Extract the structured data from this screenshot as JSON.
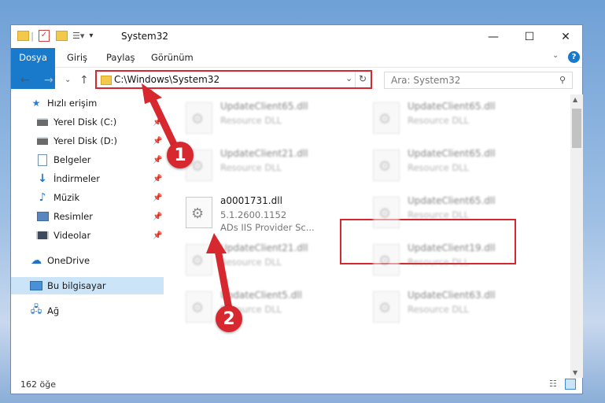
{
  "window": {
    "title": "System32"
  },
  "ribbon": {
    "tabs": [
      "Dosya",
      "Giriş",
      "Paylaş",
      "Görünüm"
    ]
  },
  "address": {
    "path": "C:\\Windows\\System32"
  },
  "search": {
    "placeholder": "Ara: System32"
  },
  "sidebar": {
    "items": [
      {
        "label": "Hızlı erişim",
        "icon": "star-icon"
      },
      {
        "label": "Yerel Disk (C:)",
        "icon": "drive-icon",
        "pinned": true
      },
      {
        "label": "Yerel Disk (D:)",
        "icon": "drive-icon",
        "pinned": true
      },
      {
        "label": "Belgeler",
        "icon": "documents-icon",
        "pinned": true
      },
      {
        "label": "İndirmeler",
        "icon": "downloads-icon",
        "pinned": true
      },
      {
        "label": "Müzik",
        "icon": "music-icon",
        "pinned": true
      },
      {
        "label": "Resimler",
        "icon": "pictures-icon",
        "pinned": true
      },
      {
        "label": "Videolar",
        "icon": "videos-icon",
        "pinned": true
      },
      {
        "label": "OneDrive",
        "icon": "cloud-icon"
      },
      {
        "label": "Bu bilgisayar",
        "icon": "computer-icon",
        "selected": true
      },
      {
        "label": "Ağ",
        "icon": "network-icon"
      }
    ]
  },
  "files": [
    {
      "name": "UpdateClient65.dll",
      "type": "Resource DLL"
    },
    {
      "name": "UpdateClient65.dll",
      "type": "Resource DLL"
    },
    {
      "name": "UpdateClient21.dll",
      "type": "Resource DLL"
    },
    {
      "name": "UpdateClient65.dll",
      "type": "Resource DLL"
    },
    {
      "name": "a0001731.dll",
      "version": "5.1.2600.1152",
      "description": "ADs IIS Provider Sc..."
    },
    {
      "name": "UpdateClient65.dll",
      "type": "Resource DLL"
    },
    {
      "name": "UpdateClient21.dll",
      "type": "Resource DLL"
    },
    {
      "name": "UpdateClient19.dll",
      "type": "Resource DLL"
    },
    {
      "name": "UpdateClient5.dll",
      "type": "Resource DLL"
    },
    {
      "name": "UpdateClient63.dll",
      "type": "Resource DLL"
    }
  ],
  "status": {
    "count": "162 öğe"
  },
  "annotations": [
    "1",
    "2"
  ],
  "colors": {
    "accent": "#1979ca",
    "highlight": "#d6282e",
    "selected": "#cce4f7"
  }
}
